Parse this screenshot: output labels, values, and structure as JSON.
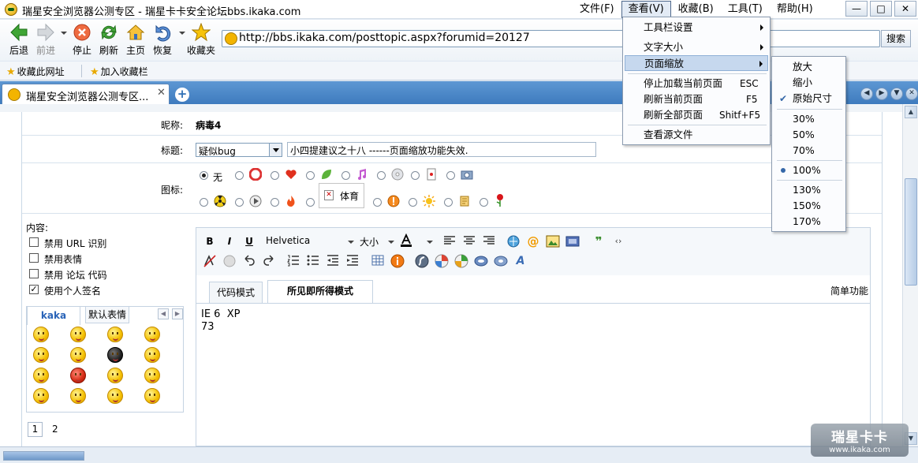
{
  "window": {
    "title": "瑞星安全浏览器公测专区 - 瑞星卡卡安全论坛bbs.ikaka.com",
    "menus": [
      "文件(F)",
      "查看(V)",
      "收藏(B)",
      "工具(T)",
      "帮助(H)"
    ],
    "controls": [
      "—",
      "□",
      "✕"
    ]
  },
  "toolbar": {
    "back": "后退",
    "forward": "前进",
    "stop": "停止",
    "refresh": "刷新",
    "home": "主页",
    "restore": "恢复",
    "favorites": "收藏夹",
    "url": "http://bbs.ikaka.com/posttopic.aspx?forumid=20127",
    "search": "搜索"
  },
  "favbar": {
    "add_url": "收藏此网址",
    "add_bar": "加入收藏栏"
  },
  "tab": {
    "label": "瑞星安全浏览器公测专区...",
    "close": "✕",
    "new": "+"
  },
  "form": {
    "nickname_label": "昵称:",
    "nickname": "病毒4",
    "title_label": "标题:",
    "category": "疑似bug",
    "title_value": "小四提建议之十八  ------页面缩放功能失效.",
    "icon_label": "图标:",
    "icon_none": "无",
    "broken_image_text": "体育",
    "content_label": "内容:",
    "options": [
      "禁用 URL 识别",
      "禁用表情",
      "禁用 论坛 代码",
      "使用个人签名"
    ],
    "emoticon_tabs": [
      "kaka",
      "默认表情"
    ],
    "pages": [
      "1",
      "2"
    ]
  },
  "editor": {
    "font": "Helvetica",
    "size": "大小",
    "bold": "B",
    "italic": "I",
    "underline": "U",
    "modes": [
      "代码模式",
      "所见即所得模式"
    ],
    "simple": "简单功能",
    "body": "IE 6  XP\n73"
  },
  "view_menu": {
    "items": [
      {
        "label": "工具栏设置",
        "shortcut": ""
      },
      {
        "label": "文字大小",
        "shortcut": ""
      },
      {
        "label": "页面缩放",
        "shortcut": ""
      },
      {
        "label": "停止加载当前页面",
        "shortcut": "ESC"
      },
      {
        "label": "刷新当前页面",
        "shortcut": "F5"
      },
      {
        "label": "刷新全部页面",
        "shortcut": "Shitf+F5"
      },
      {
        "label": "查看源文件",
        "shortcut": ""
      }
    ]
  },
  "zoom_menu": {
    "items": [
      "放大",
      "缩小",
      "原始尺寸",
      "30%",
      "50%",
      "70%",
      "100%",
      "130%",
      "150%",
      "170%"
    ],
    "checked": "原始尺寸",
    "selected": "100%"
  },
  "watermark": {
    "main": "瑞星卡卡",
    "sub": "www.ikaka.com"
  },
  "colors": {
    "accent": "#3e7bbe",
    "menu_highlight": "#c6d8ee"
  }
}
